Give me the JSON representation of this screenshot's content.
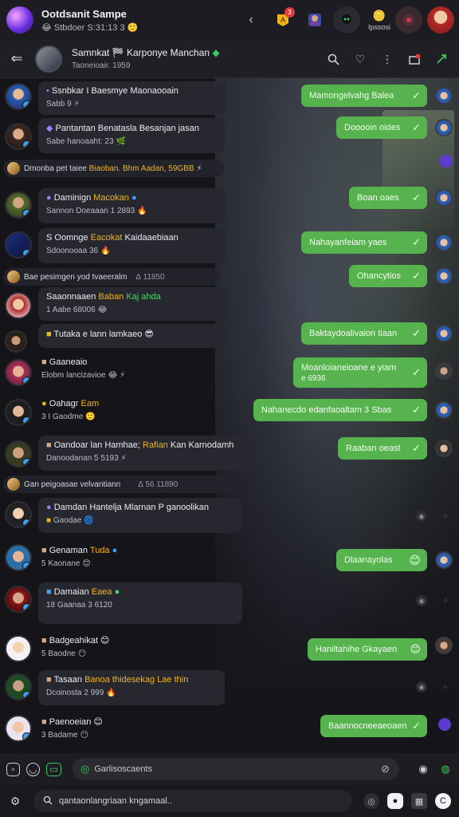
{
  "topbar": {
    "title": "Ootdsanit Sampe",
    "subtitle": "😂 Stbdoer S:31:13 3 🙂",
    "notif_badge": "3",
    "gold_badge_icon": "🪙",
    "gold_count": "Ipssosi"
  },
  "chat_header": {
    "name": "Samnkat 🏁 Karponye Manchan",
    "name_dot": "◆",
    "subtitle": "Taoneioair. 1959"
  },
  "messages": [
    {
      "type": "in",
      "line1_a": "Ssnbkar I Baesmye Maonaooain",
      "line2": "Sabb 9",
      "emoji": "⚡"
    },
    {
      "type": "in",
      "line1_a": "Pantantan Benatasla Besanjan jasan",
      "line2": "Sabe hanoaaht: 23",
      "emoji": "🌿"
    },
    {
      "type": "sys",
      "text_a": "Dmonba pet taiee",
      "text_hl": "Biaoban. Bhm Aadan, 59GBB",
      "emoji": "⚡"
    },
    {
      "type": "in",
      "line1_a": "Daminign",
      "line1_hl": "Macokan",
      "line2": "Sannon Doeaaan 1 2893",
      "emoji": "🔥"
    },
    {
      "type": "in",
      "line1_a": "S Oomnge",
      "line1_hl": "Eacokat",
      "line1_b": "Kaidaaebiaan",
      "line2": "Sdoonooaa 36",
      "emoji": "🔥"
    },
    {
      "type": "sys",
      "text_a": "Bae pesimgen yod tvaeeralm",
      "text_hl": "",
      "text_b": "∆ 11850",
      "emoji": ""
    },
    {
      "type": "in",
      "line1_a": "Saaonnaaen",
      "line1_hl": "Baban",
      "line1_g": "Kaj ahda",
      "line2": "1 Aabe 68006",
      "emoji": "😂"
    },
    {
      "type": "in",
      "line1_a": "Tutaka e lann lamkaeo",
      "line2": "",
      "emoji": "😎"
    },
    {
      "type": "in",
      "line1_a": "Gaaneaio",
      "line2": "Elobm lancizavioe",
      "emoji": "😂 ⚡"
    },
    {
      "type": "in",
      "line1_a": "Oahagr",
      "line1_hl": "Eam",
      "line2": "3 I Gaodme",
      "emoji": "🙂"
    },
    {
      "type": "in",
      "line1_a": "Oandoar lan Hamhae;",
      "line1_hl": "Rafian",
      "line1_b": "Kan Karnodamh",
      "line2": "Danoodanan 5 5193",
      "emoji": "⚡"
    },
    {
      "type": "sys",
      "text_a": "Gan peigoasae velvantiann",
      "text_hl": "",
      "text_b": "∆ 56 11890",
      "emoji": ""
    },
    {
      "type": "in",
      "line1_a": "Damdan Hantelja Mlarnan P ganoolikan",
      "line2": "Gaodae",
      "emoji": "🌀"
    },
    {
      "type": "in",
      "line1_a": "Genaman",
      "line1_hl": "Tuda",
      "line2": "5 Kaonane",
      "emoji": "😊"
    },
    {
      "type": "in",
      "line1_a": "Damaian",
      "line1_hl": "Eaea",
      "line2": "18 Gaanaa 3 6120",
      "emoji": ""
    },
    {
      "type": "in",
      "line1_a": "Badgeahikat",
      "line2": "5 Baodne",
      "emoji": "😊"
    },
    {
      "type": "in",
      "line1_a": "Tasaan",
      "line1_hl": "Banoa thidesekag Lae thin",
      "line2": "Dcoinosta 2 999",
      "emoji": "🔥"
    },
    {
      "type": "in",
      "line1_a": "Paenoeian",
      "line2": "3 Badame",
      "emoji": "😊"
    }
  ],
  "outgoing": [
    {
      "text": "Mamongelvahg Balea"
    },
    {
      "text": "Dooooin oides"
    },
    {
      "text": "Boan oaes"
    },
    {
      "text": "Nahayanfeiam yaes"
    },
    {
      "text": "Ohancytios"
    },
    {
      "text": "Baktaydoalivaion tiaan"
    },
    {
      "text": "Moanloianeioane e yiam",
      "text2": "e 6936"
    },
    {
      "text": "Nahanecdo edanfaoaltam 3 Sbas"
    },
    {
      "text": "Raaban oeast"
    },
    {
      "text": "Dlaanayolas"
    },
    {
      "text": "Haniltahihe Gkayaen"
    },
    {
      "text": "Baannocneeaeoaen"
    }
  ],
  "composer": {
    "placeholder": "Garlisoscaents"
  },
  "search": {
    "placeholder": "qantaonlangriaan kngamaal.."
  },
  "colors": {
    "accent_green": "#56b34e",
    "highlight_gold": "#f2b519",
    "online_green": "#3ec95c",
    "background": "#16161b"
  }
}
